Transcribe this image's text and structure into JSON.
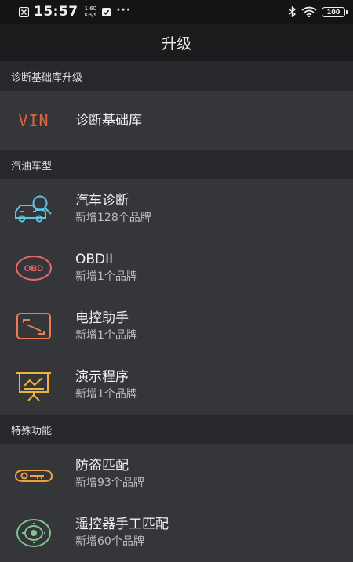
{
  "status_bar": {
    "time": "15:57",
    "net_speed_value": "1.60",
    "net_speed_unit": "KB/s",
    "more": "···",
    "battery": "100"
  },
  "header": {
    "title": "升级"
  },
  "sections": [
    {
      "header": "诊断基础库升级",
      "items": [
        {
          "icon": "vin-icon",
          "title": "诊断基础库",
          "subtitle": ""
        }
      ]
    },
    {
      "header": "汽油车型",
      "items": [
        {
          "icon": "car-diagnosis-icon",
          "title": "汽车诊断",
          "subtitle": "新增128个品牌"
        },
        {
          "icon": "obd-icon",
          "title": "OBDII",
          "subtitle": "新增1个品牌"
        },
        {
          "icon": "ecu-assistant-icon",
          "title": "电控助手",
          "subtitle": "新增1个品牌"
        },
        {
          "icon": "presentation-icon",
          "title": "演示程序",
          "subtitle": "新增1个品牌"
        }
      ]
    },
    {
      "header": "特殊功能",
      "items": [
        {
          "icon": "car-key-icon",
          "title": "防盗匹配",
          "subtitle": "新增93个品牌"
        },
        {
          "icon": "remote-control-icon",
          "title": "遥控器手工匹配",
          "subtitle": "新增60个品牌"
        }
      ]
    }
  ],
  "icon_labels": {
    "vin": "VIN",
    "obd": "OBD"
  },
  "colors": {
    "vin": "#e0643a",
    "car_diag": "#5cc6e6",
    "obd": "#e8676b",
    "ecu": "#ee7a52",
    "presentation": "#f0b43a",
    "key": "#f0a040",
    "remote": "#7fc58f"
  }
}
